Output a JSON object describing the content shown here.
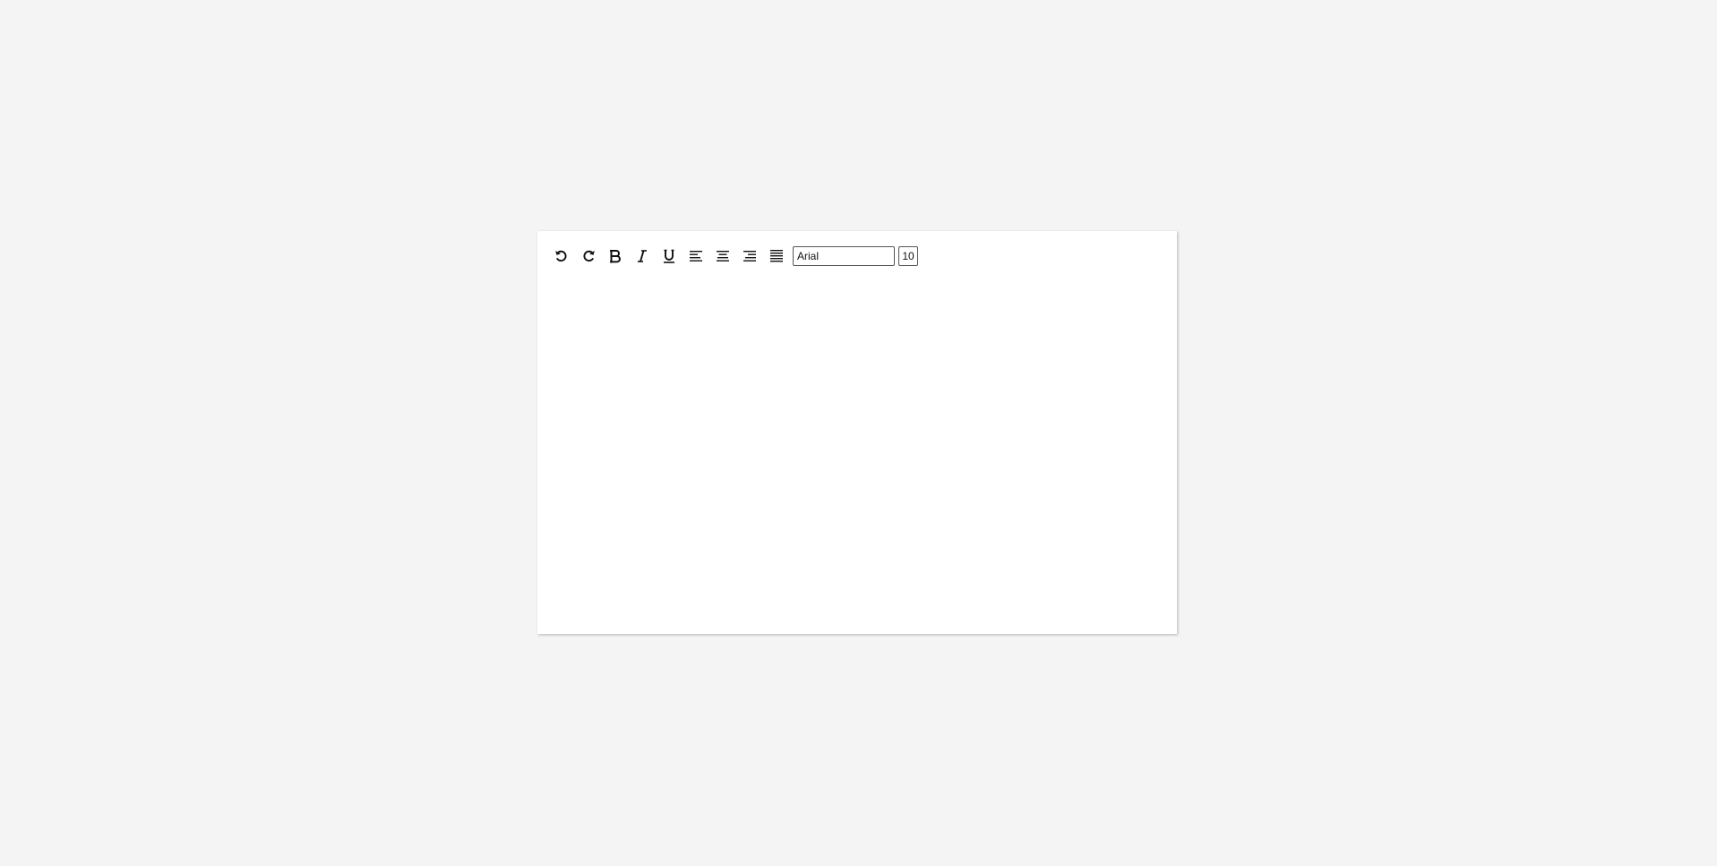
{
  "toolbar": {
    "buttons": [
      {
        "name": "undo-icon"
      },
      {
        "name": "redo-icon"
      },
      {
        "name": "bold-icon"
      },
      {
        "name": "italic-icon"
      },
      {
        "name": "underline-icon"
      },
      {
        "name": "align-left-icon"
      },
      {
        "name": "align-center-icon"
      },
      {
        "name": "align-right-icon"
      },
      {
        "name": "align-justify-icon"
      }
    ],
    "font_family": "Arial",
    "font_size": "10"
  },
  "editor": {
    "content": ""
  }
}
